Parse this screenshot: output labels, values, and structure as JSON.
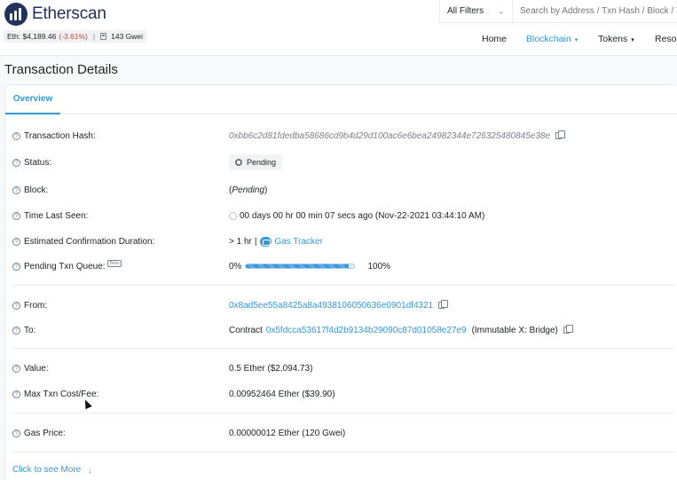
{
  "header": {
    "logo_text": "Etherscan",
    "eth_price_label": "Eth: $4,189.46",
    "eth_change": "(-3.61%)",
    "separator": "|",
    "gas_price": "143 Gwei",
    "filter_label": "All Filters",
    "search_placeholder": "Search by Address / Txn Hash / Block / Token / Ens",
    "nav": [
      "Home",
      "Blockchain",
      "Tokens",
      "Resources"
    ]
  },
  "page": {
    "title": "Transaction Details",
    "tab": "Overview"
  },
  "rows": {
    "tx_hash": {
      "label": "Transaction Hash:",
      "value": "0xbb6c2d81fdedba58686cd9b4d29d100ac6e6bea24982344e726325480845e38e"
    },
    "status": {
      "label": "Status:",
      "value": "Pending"
    },
    "block": {
      "label": "Block:",
      "value_prefix": "(",
      "value": "Pending",
      "value_suffix": ")"
    },
    "time": {
      "label": "Time Last Seen:",
      "value": "00 days 00 hr 00 min 07 secs ago (Nov-22-2021 03:44:10 AM)"
    },
    "conf": {
      "label": "Estimated Confirmation Duration:",
      "value": "> 1 hr",
      "separator": "|",
      "link": "Gas Tracker"
    },
    "queue": {
      "label": "Pending Txn Queue:",
      "beta": "Beta",
      "start": "0%",
      "end": "100%",
      "progress": 0.95
    },
    "from": {
      "label": "From:",
      "value": "0x8ad5ee55a8425a8a4938106050636e0901df4321"
    },
    "to": {
      "label": "To:",
      "prefix": "Contract",
      "value": "0x5fdcca53617f4d2b9134b29090c87d01058e27e9",
      "suffix": "(Immutable X: Bridge)"
    },
    "value": {
      "label": "Value:",
      "value": "0.5 Ether ($2,094.73)"
    },
    "fee": {
      "label": "Max Txn Cost/Fee:",
      "value": "0.00952464 Ether ($39.90)"
    },
    "gas": {
      "label": "Gas Price:",
      "value": "0.00000012 Ether (120 Gwei)"
    }
  },
  "more_label": "Click to see More",
  "colors": {
    "accent": "#3498db",
    "negative": "#de4437",
    "brand": "#21325b"
  }
}
